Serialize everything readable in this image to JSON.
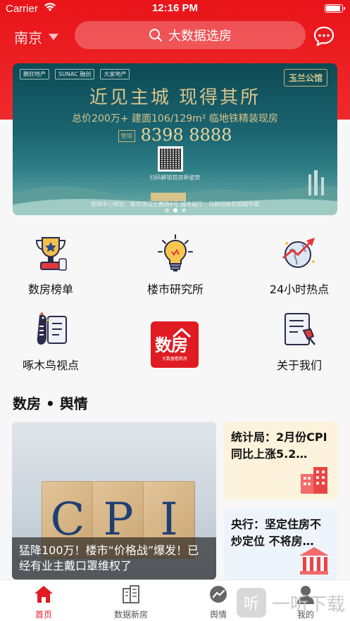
{
  "status_bar": {
    "carrier": "Carrier",
    "time": "12:16 PM"
  },
  "header": {
    "city": "南京",
    "search_placeholder": "大数据选房",
    "accent": "#e8141a"
  },
  "banner": {
    "logos": [
      "鹏欣地产",
      "SUNAC 融创",
      "大家地产"
    ],
    "brand": "玉兰公馆",
    "title": "近见主城  现得其所",
    "subtitle": "总价200万+ 建面106/129m² 临地铁精装现房",
    "phone_badge": "营销",
    "phone": "8398 8888",
    "qr_caption": "扫码解锁首房新姿势",
    "address": "营销中心地址：南京汤山上善路6号  城市展厅：马群招商花园城中庭",
    "page_count": 3,
    "active_page": 1
  },
  "menu": [
    {
      "label": "数房榜单",
      "icon": "trophy-icon"
    },
    {
      "label": "楼市研究所",
      "icon": "lightbulb-icon"
    },
    {
      "label": "24小时热点",
      "icon": "globe-arrow-icon"
    },
    {
      "label": "啄木鸟视点",
      "icon": "woodpecker-icon"
    },
    {
      "logo_text": "数房",
      "logo_sub": "大数据看新房",
      "icon": "shufang-logo"
    },
    {
      "label": "关于我们",
      "icon": "document-pin-icon"
    }
  ],
  "section": {
    "title": "数房 • 舆情"
  },
  "news": {
    "main": {
      "image_text": [
        "C",
        "P",
        "I"
      ],
      "caption": "猛降100万！楼市“价格战”爆发！已经有业主戴口罩维权了"
    },
    "side": [
      {
        "title": "统计局：2月份CPI同比上涨5.2…",
        "icon": "building-chart-icon"
      },
      {
        "title": "央行：坚定住房不炒定位 不将房…",
        "icon": "bank-icon"
      }
    ]
  },
  "tabbar": {
    "tabs": [
      {
        "label": "首页",
        "icon": "home-icon",
        "active": true
      },
      {
        "label": "数据新房",
        "icon": "buildings-icon",
        "active": false
      },
      {
        "label": "舆情",
        "icon": "trend-icon",
        "active": false
      },
      {
        "label": "我的",
        "icon": "user-icon",
        "active": false
      }
    ]
  },
  "watermark": {
    "glyph": "听",
    "text": "一听下载"
  }
}
